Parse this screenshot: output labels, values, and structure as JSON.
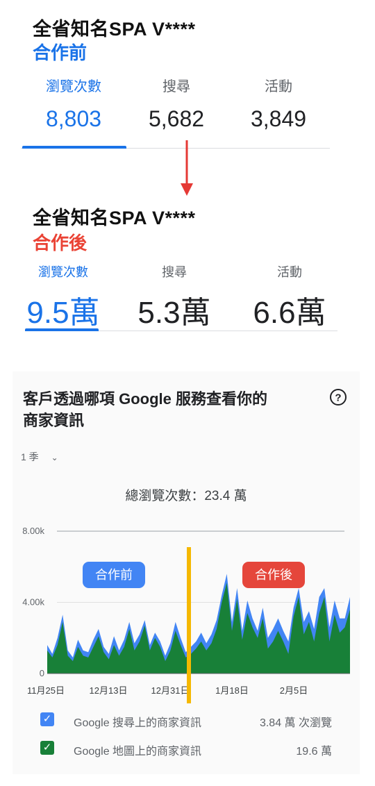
{
  "before": {
    "title": "全省知名SPA V****",
    "subtitle": "合作前",
    "tabs": [
      {
        "label": "瀏覽次數",
        "value": "8,803"
      },
      {
        "label": "搜尋",
        "value": "5,682"
      },
      {
        "label": "活動",
        "value": "3,849"
      }
    ]
  },
  "after": {
    "title": "全省知名SPA V****",
    "subtitle": "合作後",
    "tabs": [
      {
        "label": "瀏覽次數",
        "value": "9.5萬"
      },
      {
        "label": "搜尋",
        "value": "5.3萬"
      },
      {
        "label": "活動",
        "value": "6.6萬"
      }
    ]
  },
  "card": {
    "title_line1": "客戶透過哪項 Google 服務查看你的",
    "title_line2": "商家資訊",
    "period": "1 季",
    "total_label": "總瀏覽次數：23.4 萬",
    "before_tag": "合作前",
    "after_tag": "合作後",
    "legend": [
      {
        "label": "Google 搜尋上的商家資訊",
        "value": "3.84 萬 次瀏覽",
        "color": "#4285f4"
      },
      {
        "label": "Google 地圖上的商家資訊",
        "value": "19.6 萬",
        "color": "#188038"
      }
    ]
  },
  "colors": {
    "blue": "#1a73e8",
    "red": "#ea4335",
    "marker": "#f5b800",
    "search": "#4285f4",
    "maps": "#188038"
  },
  "chart_data": {
    "type": "area",
    "ylim": [
      0,
      8000
    ],
    "y_ticks": [
      "0",
      "4.00k",
      "8.00k"
    ],
    "x_ticks": [
      "11月25日",
      "12月13日",
      "12月31日",
      "1月18日",
      "2月5日"
    ],
    "series": [
      {
        "name": "Google 地圖上的商家資訊",
        "values": [
          1300,
          900,
          1600,
          2900,
          1000,
          700,
          1500,
          1000,
          900,
          1500,
          2100,
          1200,
          800,
          1600,
          1000,
          1500,
          2500,
          1300,
          1800,
          2700,
          1300,
          2000,
          1500,
          700,
          1300,
          2400,
          1600,
          900,
          1100,
          1400,
          1800,
          1300,
          1700,
          2500,
          4000,
          5100,
          2400,
          4200,
          1900,
          3400,
          2600,
          2000,
          3100,
          1400,
          1800,
          2400,
          1800,
          1100,
          3200,
          4300,
          2200,
          2900,
          1800,
          3400,
          4300,
          1800,
          3300,
          2300,
          2600,
          3600
        ]
      },
      {
        "name": "Google 搜尋上的商家資訊",
        "values": [
          1600,
          1100,
          2000,
          3300,
          1300,
          900,
          1900,
          1300,
          1200,
          1900,
          2500,
          1500,
          1100,
          2100,
          1300,
          1900,
          2900,
          1700,
          2200,
          3000,
          1600,
          2300,
          1800,
          1000,
          1700,
          2900,
          2000,
          1200,
          1500,
          1800,
          2300,
          1700,
          2200,
          3000,
          4400,
          5600,
          2900,
          4800,
          2400,
          4100,
          3100,
          2400,
          3700,
          2000,
          2500,
          3100,
          2400,
          1800,
          3700,
          4800,
          2900,
          3500,
          2500,
          4300,
          4800,
          2600,
          4100,
          3100,
          3100,
          4300
        ]
      }
    ]
  }
}
